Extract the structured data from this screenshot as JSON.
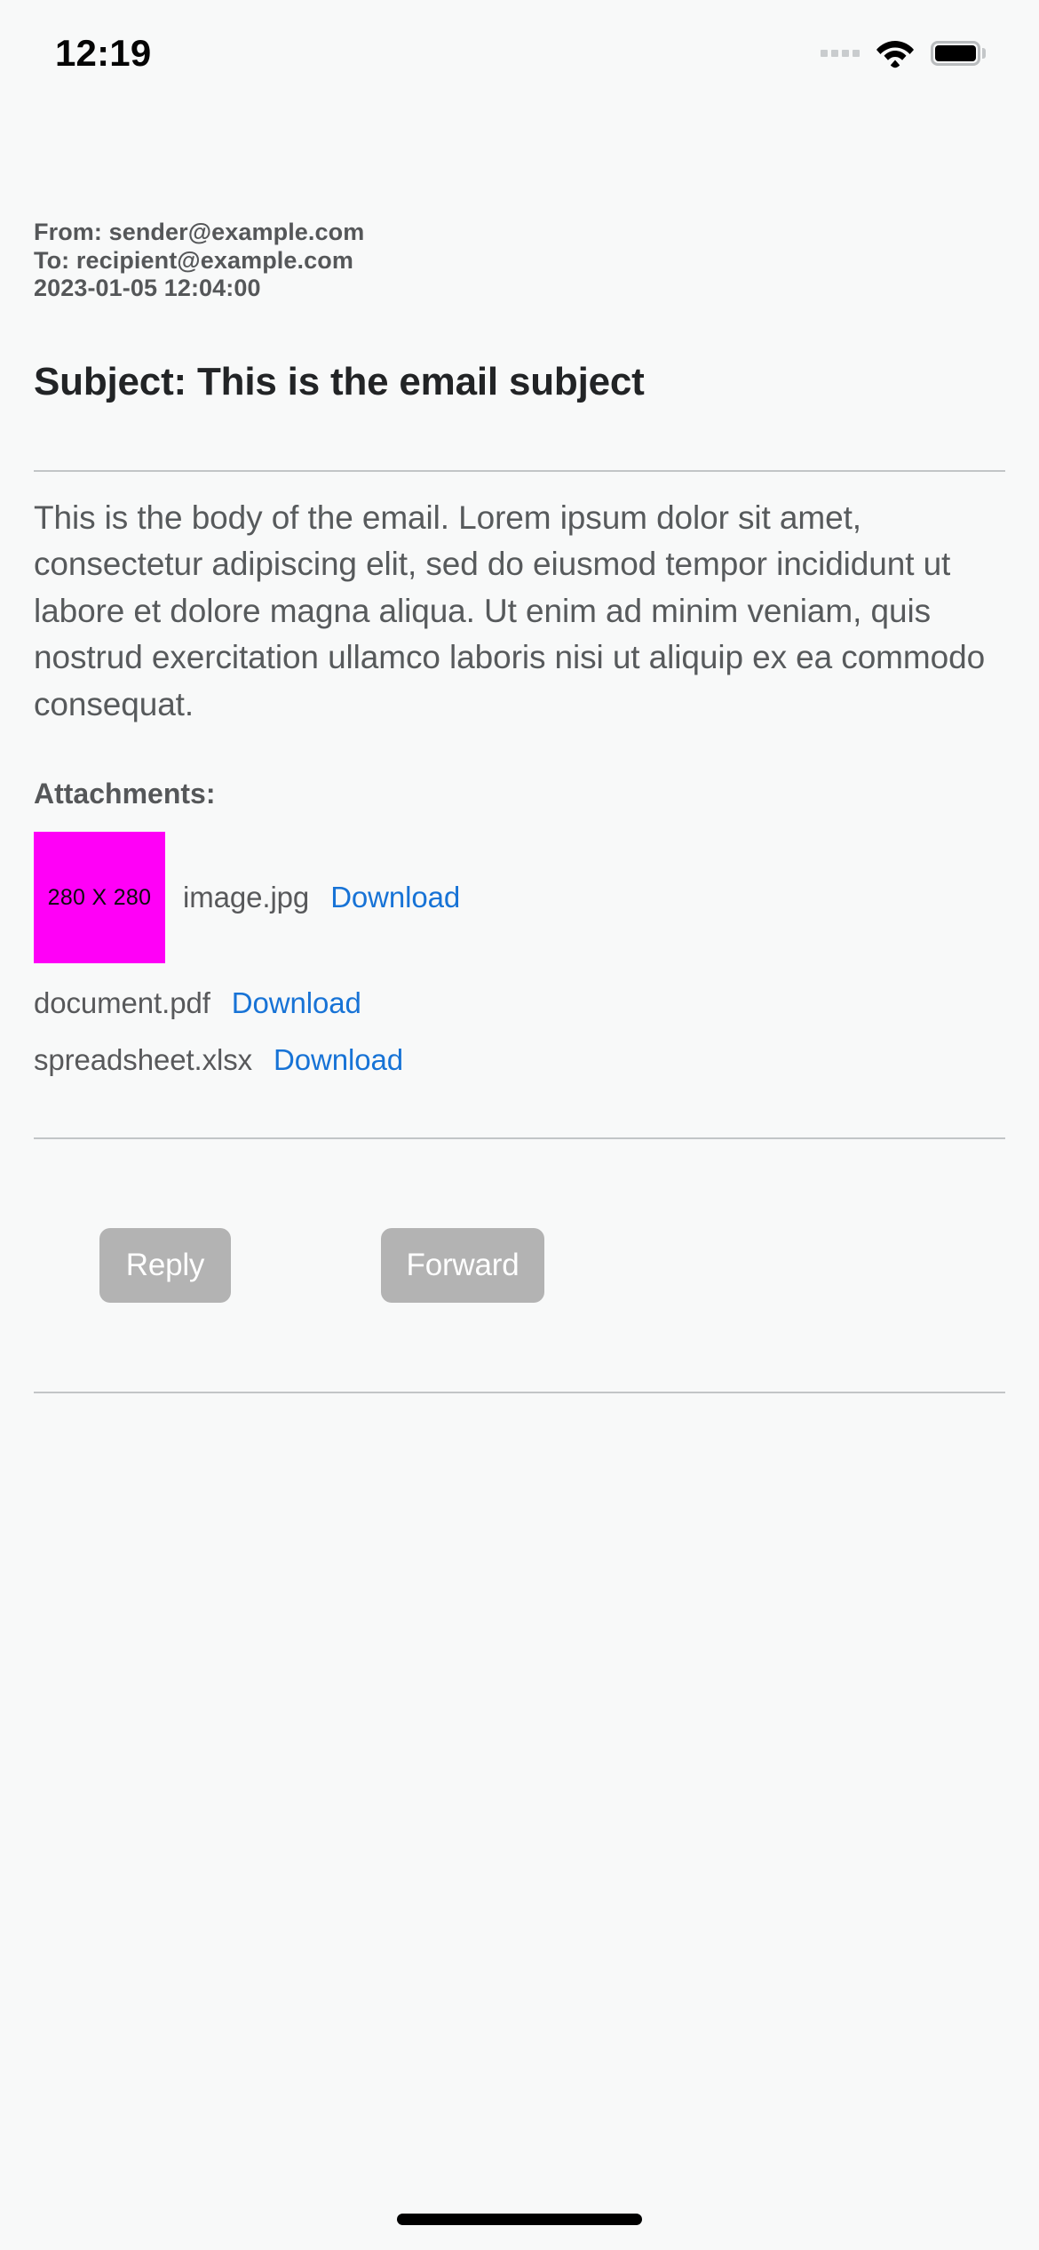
{
  "status_bar": {
    "time": "12:19",
    "signal_icon": "signal-dots-icon",
    "wifi_icon": "wifi-icon",
    "battery_icon": "battery-full-icon"
  },
  "email": {
    "from_line": "From: sender@example.com",
    "to_line": "To: recipient@example.com",
    "date_line": "2023-01-05 12:04:00",
    "subject": "Subject: This is the email subject",
    "body": "This is the body of the email. Lorem ipsum dolor sit amet, consectetur adipiscing elit, sed do eiusmod tempor incididunt ut labore et dolore magna aliqua. Ut enim ad minim veniam, quis nostrud exercitation ullamco laboris nisi ut aliquip ex ea commodo consequat."
  },
  "attachments": {
    "heading": "Attachments:",
    "items": [
      {
        "name": "image.jpg",
        "link_label": "Download",
        "thumbnail_label": "280 X 280",
        "thumbnail_color": "#ff00f7"
      },
      {
        "name": "document.pdf",
        "link_label": "Download"
      },
      {
        "name": "spreadsheet.xlsx",
        "link_label": "Download"
      }
    ]
  },
  "actions": {
    "reply_label": "Reply",
    "forward_label": "Forward"
  },
  "colors": {
    "background": "#f8f9f9",
    "link": "#1773d6",
    "button": "#b3b3b3",
    "divider": "#c2c5c7",
    "text": "#575a5c"
  }
}
